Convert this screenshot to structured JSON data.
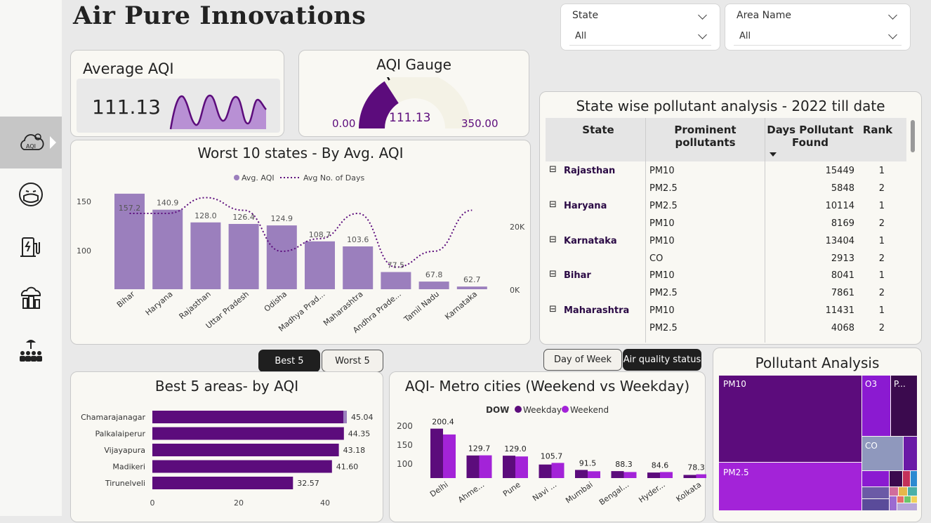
{
  "app_title": "Air Pure Innovations",
  "colors": {
    "dark_purple": "#5c0c7c",
    "bright_purple": "#a323d8",
    "lavender": "#9b7fbd",
    "card_bg": "#f9f8f3"
  },
  "sidebar": {
    "items": [
      {
        "icon": "aqi-cloud-icon",
        "active": true
      },
      {
        "icon": "mask-face-icon",
        "active": false
      },
      {
        "icon": "ev-charger-icon",
        "active": false
      },
      {
        "icon": "city-pollution-icon",
        "active": false
      },
      {
        "icon": "community-tree-icon",
        "active": false
      }
    ]
  },
  "slicers": {
    "state": {
      "label": "State",
      "value": "All"
    },
    "area": {
      "label": "Area Name",
      "value": "All"
    }
  },
  "avg_aqi": {
    "title": "Average AQI",
    "value": "111.13"
  },
  "gauge": {
    "title": "AQI Gauge",
    "min": "0.00",
    "max": "350.00",
    "value": "111.13",
    "fraction": 0.3175
  },
  "toggle_best_worst": {
    "best": "Best 5",
    "worst": "Worst 5"
  },
  "toggle_metro": {
    "day": "Day of Week",
    "air": "Air quality status"
  },
  "pollutant_table": {
    "title": "State wise pollutant analysis - 2022 till date",
    "headers": [
      "State",
      "Prominent pollutants",
      "Days Pollutant Found",
      "Rank"
    ],
    "groups": [
      {
        "state": "Rajasthan",
        "rows": [
          [
            "PM10",
            "15449",
            "1"
          ],
          [
            "PM2.5",
            "5848",
            "2"
          ]
        ]
      },
      {
        "state": "Haryana",
        "rows": [
          [
            "PM2.5",
            "10114",
            "1"
          ],
          [
            "PM10",
            "8169",
            "2"
          ]
        ]
      },
      {
        "state": "Karnataka",
        "rows": [
          [
            "PM10",
            "13404",
            "1"
          ],
          [
            "CO",
            "2913",
            "2"
          ]
        ]
      },
      {
        "state": "Bihar",
        "rows": [
          [
            "PM10",
            "8041",
            "1"
          ],
          [
            "PM2.5",
            "7861",
            "2"
          ]
        ]
      },
      {
        "state": "Maharashtra",
        "rows": [
          [
            "PM10",
            "11431",
            "1"
          ],
          [
            "PM2.5",
            "4068",
            "2"
          ]
        ]
      }
    ]
  },
  "chart_data": [
    {
      "id": "worst10",
      "type": "bar",
      "title": "Worst 10 states - By Avg. AQI",
      "legend": [
        "Avg. AQI",
        "Avg No. of Days"
      ],
      "categories": [
        "Bihar",
        "Haryana",
        "Rajasthan",
        "Uttar Pradesh",
        "Odisha",
        "Madhya Prad...",
        "Maharashtra",
        "Andhra Prade...",
        "Tamil Nadu",
        "Karnataka"
      ],
      "series": [
        {
          "name": "Avg. AQI",
          "values": [
            157.2,
            140.9,
            128.0,
            126.4,
            124.9,
            108.7,
            103.6,
            77.5,
            67.8,
            62.7
          ],
          "labels": [
            "157.2",
            "140.9",
            "128.0",
            "126.4",
            "124.9",
            "108.7",
            "103.6",
            "77.5",
            "67.8",
            "62.7"
          ]
        },
        {
          "name": "Avg No. of Days",
          "values": [
            24000,
            24000,
            29000,
            25000,
            12000,
            16000,
            24000,
            7000,
            12000,
            25000
          ]
        }
      ],
      "y_ticks": [
        "150",
        "100"
      ],
      "y2_ticks": [
        "20K",
        "0K"
      ]
    },
    {
      "id": "best5",
      "type": "bar",
      "orientation": "horizontal",
      "title": "Best 5 areas- by AQI",
      "categories": [
        "Chamarajanagar",
        "Palkalaiperur",
        "Vijayapura",
        "Madikeri",
        "Tirunelveli"
      ],
      "values": [
        45.04,
        44.35,
        43.18,
        41.6,
        32.57
      ],
      "labels": [
        "45.04",
        "44.35",
        "43.18",
        "41.60",
        "32.57"
      ],
      "x_ticks": [
        "0",
        "20",
        "40"
      ]
    },
    {
      "id": "metro",
      "type": "bar",
      "title": "AQI- Metro cities (Weekend vs Weekday)",
      "legend_title": "DOW",
      "legend": [
        "Weekday",
        "Weekend"
      ],
      "categories": [
        "Delhi",
        "Ahme...",
        "Pune",
        "Navi ...",
        "Mumbai",
        "Bengal...",
        "Hyder...",
        "Kolkata"
      ],
      "series": [
        {
          "name": "Weekday",
          "values": [
            200.4,
            129.7,
            129.0,
            105.7,
            91.5,
            88.3,
            84.6,
            78.3
          ]
        },
        {
          "name": "Weekend",
          "values": [
            185,
            130,
            127,
            110,
            88,
            86,
            86,
            80
          ]
        }
      ],
      "labels": [
        "200.4",
        "129.7",
        "129.0",
        "105.7",
        "91.5",
        "88.3",
        "84.6",
        "78.3"
      ],
      "y_ticks": [
        "200",
        "150",
        "100"
      ]
    }
  ],
  "treemap": {
    "title": "Pollutant Analysis",
    "labels": [
      "PM10",
      "O3",
      "P...",
      "CO",
      "PM2.5"
    ]
  }
}
